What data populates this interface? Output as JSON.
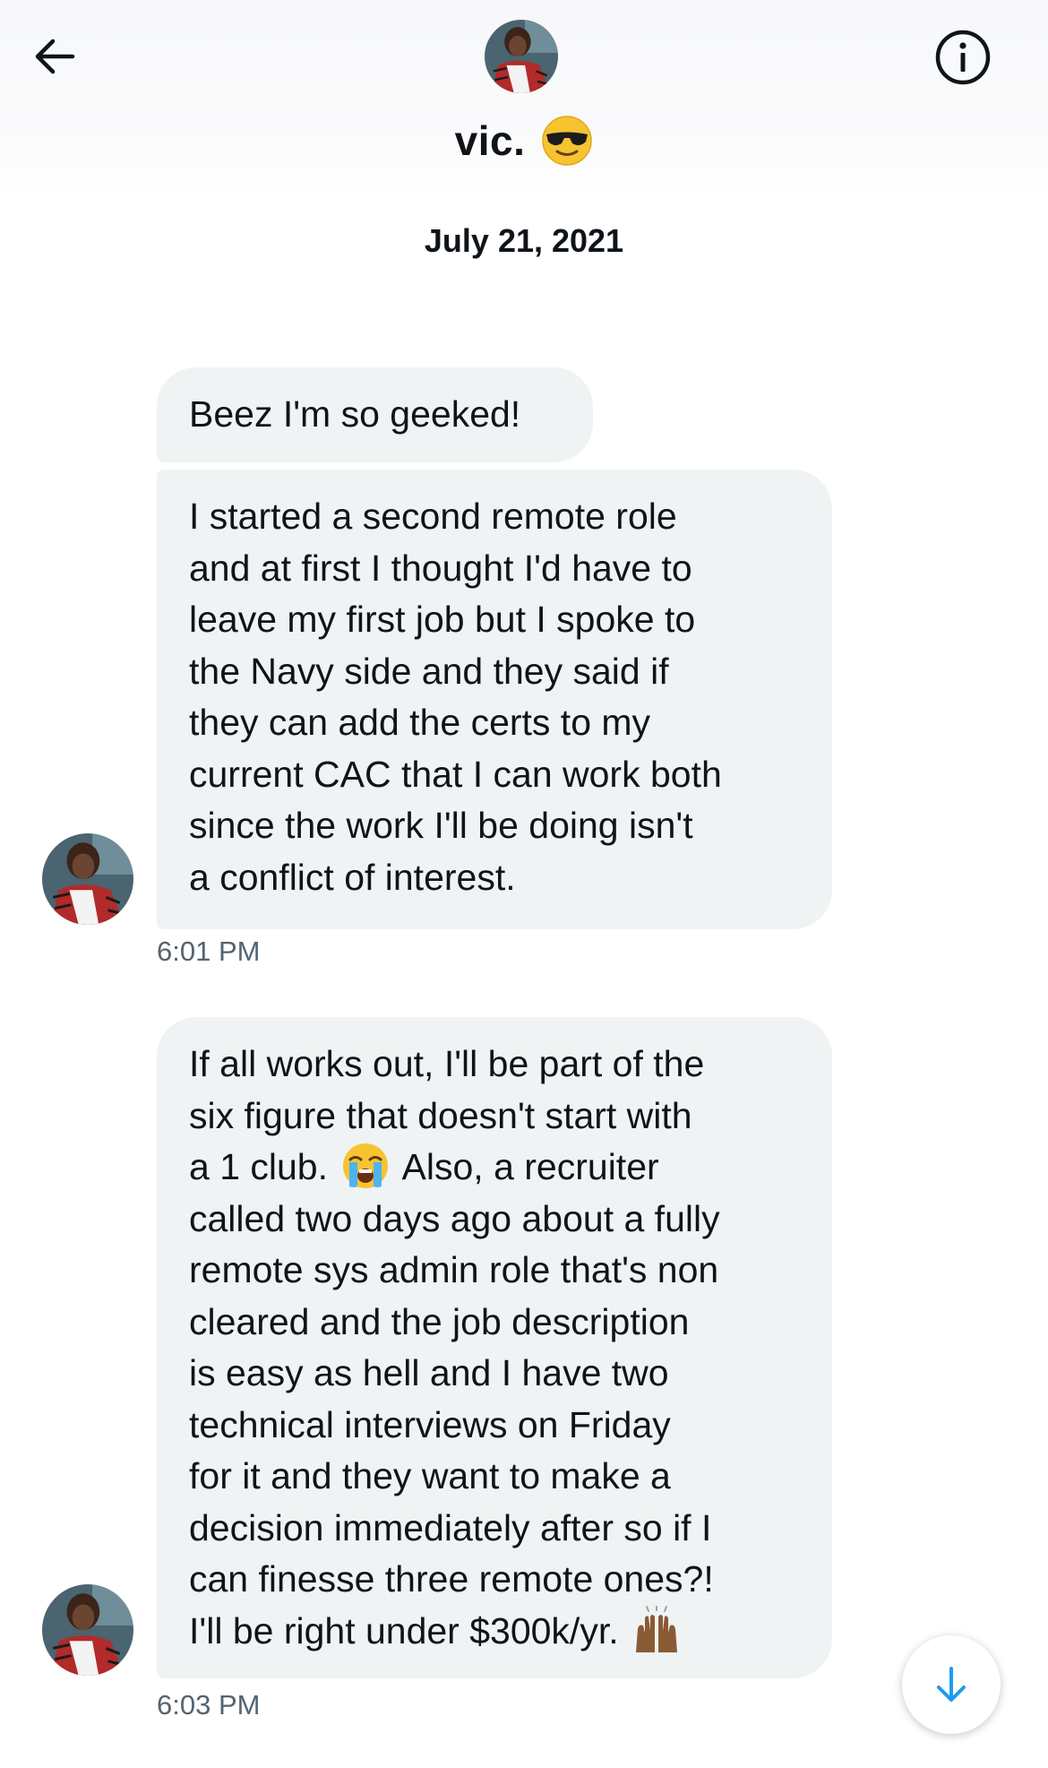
{
  "header": {
    "name": "vic.",
    "name_emoji": "smiling-face-with-sunglasses",
    "back_icon": "arrow-left-icon",
    "info_icon": "info-icon"
  },
  "conversation": {
    "date": "July 21, 2021",
    "groups": [
      {
        "messages": [
          {
            "lines": [
              "Beez I'm so geeked!"
            ]
          },
          {
            "lines": [
              "I started a second remote role",
              "and at first I thought I'd have to",
              "leave my first job but I spoke to",
              "the Navy side and they said if",
              "they can add the certs to my",
              "current CAC that I can work both",
              "since the work I'll be doing isn't",
              "a conflict of interest."
            ]
          }
        ],
        "time": "6:01 PM"
      },
      {
        "messages": [
          {
            "lines": [
              "If all works out, I'll be part of the",
              "six figure that doesn't start with",
              "a 1 club.",
              "Also, a recruiter",
              "called two days ago about a fully",
              "remote sys admin role that's non",
              "cleared and the job description",
              "is easy as hell and I have two",
              "technical interviews on Friday",
              "for it and they want to make a",
              "decision immediately after so if I",
              "can finesse three remote ones?!",
              "I'll be right under $300k/yr."
            ],
            "emojis": [
              "loudly-crying-face",
              "raising-hands"
            ]
          }
        ],
        "time": "6:03 PM"
      }
    ]
  },
  "colors": {
    "bubble_bg": "#eff3f4",
    "text": "#0f1419",
    "muted": "#536471",
    "accent": "#1d9bf0"
  },
  "scroll_button": {
    "icon": "arrow-down-icon"
  }
}
